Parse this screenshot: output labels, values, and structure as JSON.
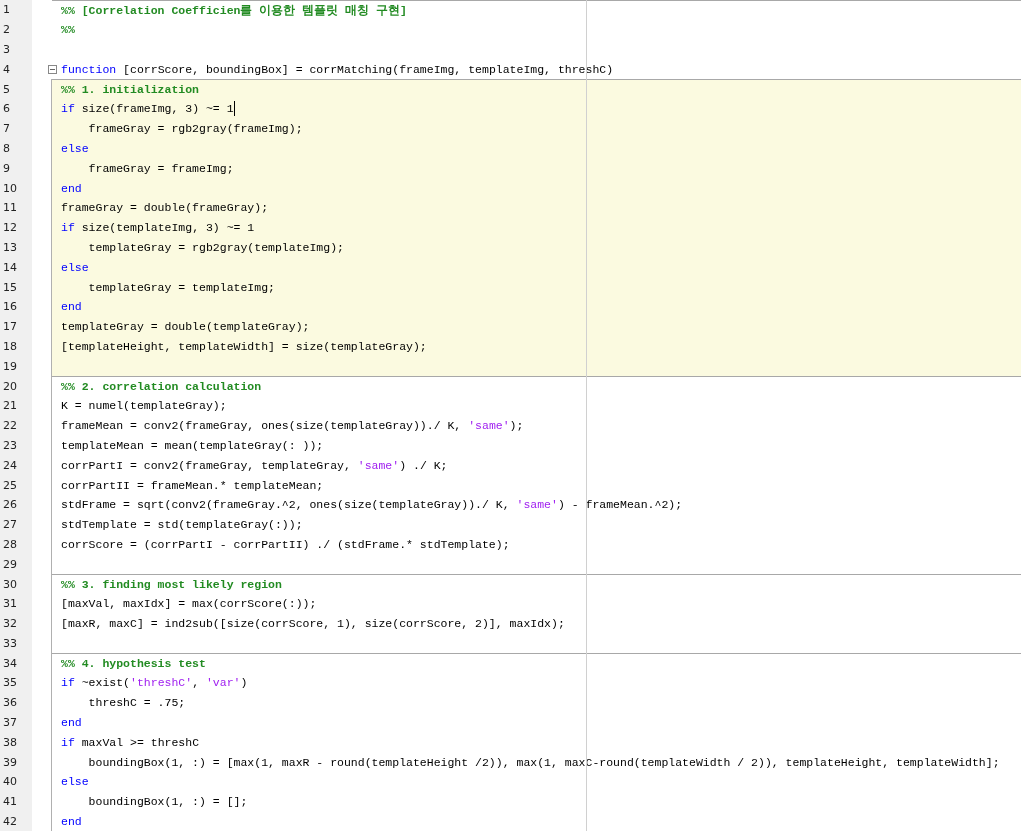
{
  "editor": {
    "lines": [
      {
        "number": "1",
        "cell_break": true,
        "highlighted": false,
        "tokens": [
          {
            "kind": "section",
            "text": "%% [Correlation Coefficien를 이용한 템플릿 매칭 구현]"
          }
        ]
      },
      {
        "number": "2",
        "cell_break": false,
        "highlighted": false,
        "tokens": [
          {
            "kind": "section",
            "text": "%%"
          }
        ]
      },
      {
        "number": "3",
        "cell_break": false,
        "highlighted": false
      },
      {
        "number": "4",
        "cell_break": false,
        "highlighted": false,
        "foldable": true,
        "tokens": [
          {
            "kind": "keyword",
            "text": "function"
          },
          {
            "kind": "code",
            "text": " [corrScore, boundingBox] = corrMatching(frameImg, templateImg, threshC)"
          }
        ]
      },
      {
        "number": "5",
        "cell_break": true,
        "highlighted": true,
        "tokens": [
          {
            "kind": "section",
            "text": "%% 1. initialization"
          }
        ]
      },
      {
        "number": "6",
        "cell_break": false,
        "highlighted": true,
        "cursor": true,
        "tokens": [
          {
            "kind": "keyword",
            "text": "if"
          },
          {
            "kind": "code",
            "text": " size(frameImg, 3) ~= 1"
          }
        ]
      },
      {
        "number": "7",
        "cell_break": false,
        "highlighted": true,
        "tokens": [
          {
            "kind": "code",
            "text": "    frameGray = rgb2gray(frameImg);"
          }
        ]
      },
      {
        "number": "8",
        "cell_break": false,
        "highlighted": true,
        "tokens": [
          {
            "kind": "keyword",
            "text": "else"
          }
        ]
      },
      {
        "number": "9",
        "cell_break": false,
        "highlighted": true,
        "tokens": [
          {
            "kind": "code",
            "text": "    frameGray = frameImg;"
          }
        ]
      },
      {
        "number": "10",
        "cell_break": false,
        "highlighted": true,
        "tokens": [
          {
            "kind": "keyword",
            "text": "end"
          }
        ]
      },
      {
        "number": "11",
        "cell_break": false,
        "highlighted": true,
        "tokens": [
          {
            "kind": "code",
            "text": "frameGray = double(frameGray);"
          }
        ]
      },
      {
        "number": "12",
        "cell_break": false,
        "highlighted": true,
        "tokens": [
          {
            "kind": "keyword",
            "text": "if"
          },
          {
            "kind": "code",
            "text": " size(templateImg, 3) ~= 1"
          }
        ]
      },
      {
        "number": "13",
        "cell_break": false,
        "highlighted": true,
        "tokens": [
          {
            "kind": "code",
            "text": "    templateGray = rgb2gray(templateImg);"
          }
        ]
      },
      {
        "number": "14",
        "cell_break": false,
        "highlighted": true,
        "tokens": [
          {
            "kind": "keyword",
            "text": "else"
          }
        ]
      },
      {
        "number": "15",
        "cell_break": false,
        "highlighted": true,
        "tokens": [
          {
            "kind": "code",
            "text": "    templateGray = templateImg;"
          }
        ]
      },
      {
        "number": "16",
        "cell_break": false,
        "highlighted": true,
        "tokens": [
          {
            "kind": "keyword",
            "text": "end"
          }
        ]
      },
      {
        "number": "17",
        "cell_break": false,
        "highlighted": true,
        "tokens": [
          {
            "kind": "code",
            "text": "templateGray = double(templateGray);"
          }
        ]
      },
      {
        "number": "18",
        "cell_break": false,
        "highlighted": true,
        "tokens": [
          {
            "kind": "code",
            "text": "[templateHeight, templateWidth] = size(templateGray);"
          }
        ]
      },
      {
        "number": "19",
        "cell_break": false,
        "highlighted": true
      },
      {
        "number": "20",
        "cell_break": true,
        "highlighted": false,
        "tokens": [
          {
            "kind": "section",
            "text": "%% 2. correlation calculation"
          }
        ]
      },
      {
        "number": "21",
        "cell_break": false,
        "highlighted": false,
        "tokens": [
          {
            "kind": "code",
            "text": "K = numel(templateGray);"
          }
        ]
      },
      {
        "number": "22",
        "cell_break": false,
        "highlighted": false,
        "tokens": [
          {
            "kind": "code",
            "text": "frameMean = conv2(frameGray, ones(size(templateGray))./ K, "
          },
          {
            "kind": "string",
            "text": "'same'"
          },
          {
            "kind": "code",
            "text": ");"
          }
        ]
      },
      {
        "number": "23",
        "cell_break": false,
        "highlighted": false,
        "tokens": [
          {
            "kind": "code",
            "text": "templateMean = mean(templateGray(: ));"
          }
        ]
      },
      {
        "number": "24",
        "cell_break": false,
        "highlighted": false,
        "tokens": [
          {
            "kind": "code",
            "text": "corrPartI = conv2(frameGray, templateGray, "
          },
          {
            "kind": "string",
            "text": "'same'"
          },
          {
            "kind": "code",
            "text": ") ./ K;"
          }
        ]
      },
      {
        "number": "25",
        "cell_break": false,
        "highlighted": false,
        "tokens": [
          {
            "kind": "code",
            "text": "corrPartII = frameMean.* templateMean;"
          }
        ]
      },
      {
        "number": "26",
        "cell_break": false,
        "highlighted": false,
        "tokens": [
          {
            "kind": "code",
            "text": "stdFrame = sqrt(conv2(frameGray.^2, ones(size(templateGray))./ K, "
          },
          {
            "kind": "string",
            "text": "'same'"
          },
          {
            "kind": "code",
            "text": ") - frameMean.^2);"
          }
        ]
      },
      {
        "number": "27",
        "cell_break": false,
        "highlighted": false,
        "tokens": [
          {
            "kind": "code",
            "text": "stdTemplate = std(templateGray(:));"
          }
        ]
      },
      {
        "number": "28",
        "cell_break": false,
        "highlighted": false,
        "tokens": [
          {
            "kind": "code",
            "text": "corrScore = (corrPartI - corrPartII) ./ (stdFrame.* stdTemplate);"
          }
        ]
      },
      {
        "number": "29",
        "cell_break": false,
        "highlighted": false
      },
      {
        "number": "30",
        "cell_break": true,
        "highlighted": false,
        "tokens": [
          {
            "kind": "section",
            "text": "%% 3. finding most likely region"
          }
        ]
      },
      {
        "number": "31",
        "cell_break": false,
        "highlighted": false,
        "tokens": [
          {
            "kind": "code",
            "text": "[maxVal, maxIdx] = max(corrScore(:));"
          }
        ]
      },
      {
        "number": "32",
        "cell_break": false,
        "highlighted": false,
        "tokens": [
          {
            "kind": "code",
            "text": "[maxR, maxC] = ind2sub([size(corrScore, 1), size(corrScore, 2)], maxIdx);"
          }
        ]
      },
      {
        "number": "33",
        "cell_break": false,
        "highlighted": false
      },
      {
        "number": "34",
        "cell_break": true,
        "highlighted": false,
        "tokens": [
          {
            "kind": "section",
            "text": "%% 4. hypothesis test"
          }
        ]
      },
      {
        "number": "35",
        "cell_break": false,
        "highlighted": false,
        "tokens": [
          {
            "kind": "keyword",
            "text": "if"
          },
          {
            "kind": "code",
            "text": " ~exist("
          },
          {
            "kind": "string",
            "text": "'threshC'"
          },
          {
            "kind": "code",
            "text": ", "
          },
          {
            "kind": "string",
            "text": "'var'"
          },
          {
            "kind": "code",
            "text": ")"
          }
        ]
      },
      {
        "number": "36",
        "cell_break": false,
        "highlighted": false,
        "tokens": [
          {
            "kind": "code",
            "text": "    threshC = .75;"
          }
        ]
      },
      {
        "number": "37",
        "cell_break": false,
        "highlighted": false,
        "tokens": [
          {
            "kind": "keyword",
            "text": "end"
          }
        ]
      },
      {
        "number": "38",
        "cell_break": false,
        "highlighted": false,
        "tokens": [
          {
            "kind": "keyword",
            "text": "if"
          },
          {
            "kind": "code",
            "text": " maxVal >= threshC"
          }
        ]
      },
      {
        "number": "39",
        "cell_break": false,
        "highlighted": false,
        "tokens": [
          {
            "kind": "code",
            "text": "    boundingBox(1, :) = [max(1, maxR - round(templateHeight /2)), max(1, maxC-round(templateWidth / 2)), templateHeight, templateWidth];"
          }
        ]
      },
      {
        "number": "40",
        "cell_break": false,
        "highlighted": false,
        "tokens": [
          {
            "kind": "keyword",
            "text": "else"
          }
        ]
      },
      {
        "number": "41",
        "cell_break": false,
        "highlighted": false,
        "tokens": [
          {
            "kind": "code",
            "text": "    boundingBox(1, :) = [];"
          }
        ]
      },
      {
        "number": "42",
        "cell_break": false,
        "highlighted": false,
        "tokens": [
          {
            "kind": "keyword",
            "text": "end"
          }
        ]
      }
    ]
  }
}
